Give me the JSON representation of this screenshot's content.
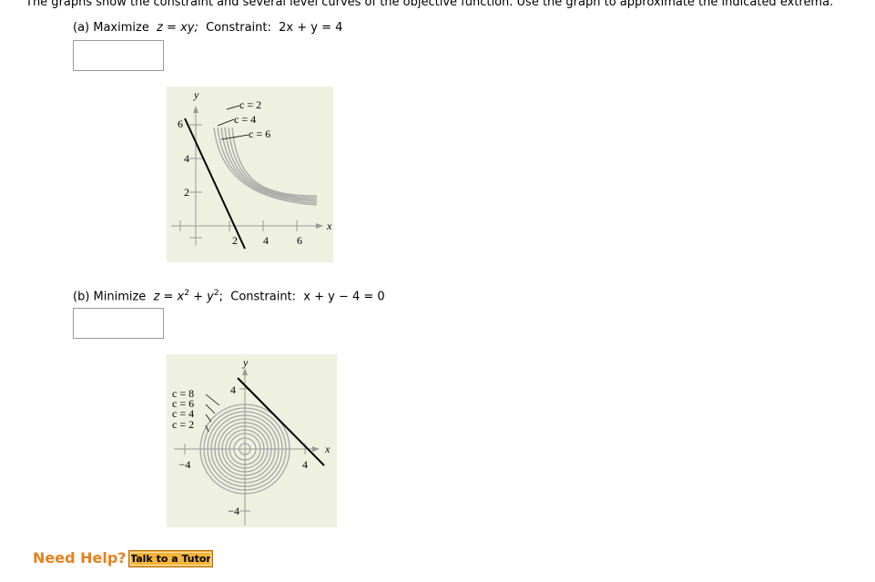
{
  "instructions": "The graphs show the constraint and several level curves of the objective function. Use the graph to approximate the indicated extrema.",
  "part_a": {
    "label_prefix": "(a) Maximize",
    "objective": "z = xy;",
    "constraint_label": "Constraint:",
    "constraint": "2x + y = 4",
    "answer_value": "",
    "graph": {
      "y_axis_label": "y",
      "x_axis_label": "x",
      "y_ticks": [
        "6",
        "4",
        "2"
      ],
      "x_ticks": [
        "2",
        "4",
        "6"
      ],
      "level_labels": [
        "c = 2",
        "c = 4",
        "c = 6"
      ]
    }
  },
  "part_b": {
    "label_prefix": "(b) Minimize",
    "objective_base": "z = x",
    "exp1": "2",
    "plus": " + y",
    "exp2": "2",
    "semicolon": ";",
    "constraint_label": "Constraint:",
    "constraint": "x + y − 4 = 0",
    "answer_value": "",
    "graph": {
      "y_axis_label": "y",
      "x_axis_label": "x",
      "y_ticks": [
        "4",
        "−4"
      ],
      "x_ticks": [
        "−4",
        "4"
      ],
      "level_labels": [
        "c = 8",
        "c = 6",
        "c = 4",
        "c = 2"
      ]
    }
  },
  "help": {
    "label": "Need Help?",
    "button": "Talk to a Tutor"
  },
  "colors": {
    "graph_bg": "#eef0e0",
    "curve": "#a6a6a6",
    "help_text": "#e8801f",
    "tutor_bg": "#f5b339"
  }
}
